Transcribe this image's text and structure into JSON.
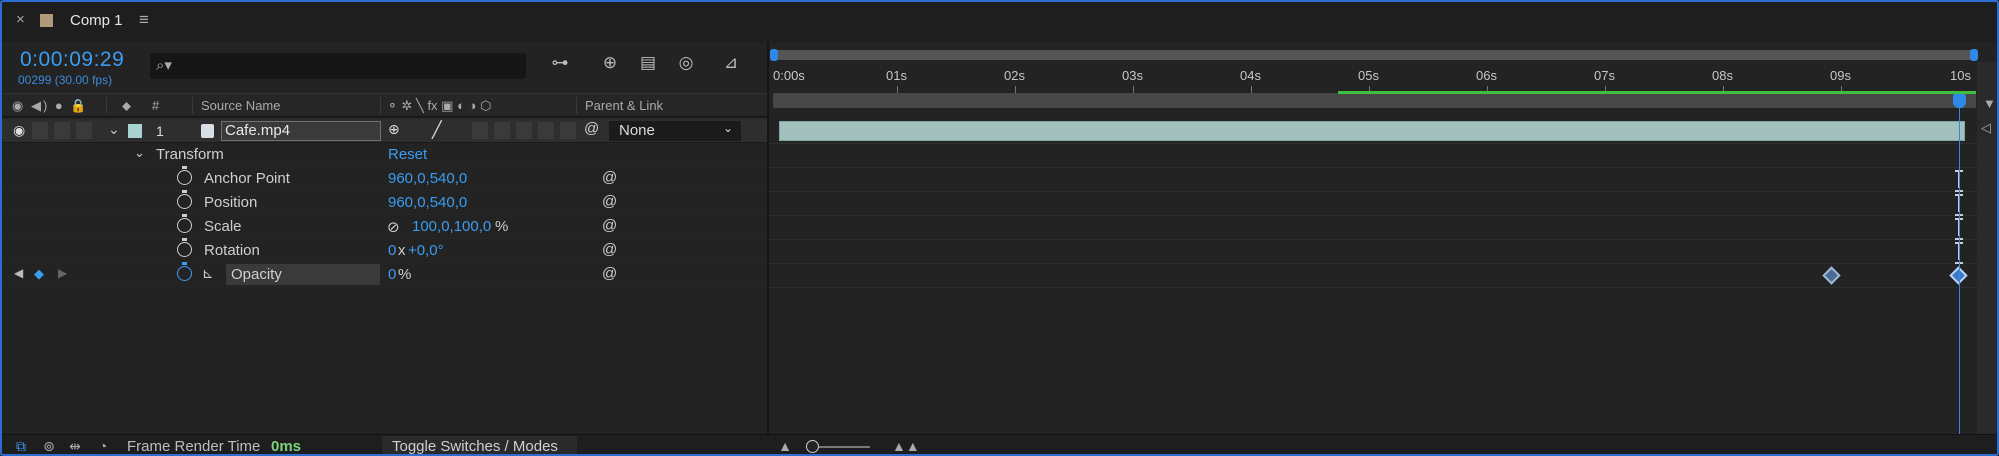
{
  "tab": {
    "close": "×",
    "title": "Comp 1",
    "menu": "≡"
  },
  "header": {
    "timecode": "0:00:09:29",
    "frame_info": "00299 (30.00 fps)",
    "search": {
      "placeholder": "",
      "icon": "search-icon"
    }
  },
  "columns": {
    "switch_icons": "◉ ◀) ● 🔒",
    "label": "⬥",
    "number": "#",
    "source_name": "Source Name",
    "switches": "⚬ ✲ ╲ fx ▣ ◐ ◑ ⬡",
    "parent": "Parent & Link"
  },
  "layer": {
    "number": "1",
    "name": "Cafe.mp4",
    "label_color": "#a9d3d0",
    "parent": "None",
    "parent_chevron": "⌄"
  },
  "transform": {
    "label": "Transform",
    "reset": "Reset",
    "properties": [
      {
        "name": "Anchor Point",
        "value": "960,0,540,0"
      },
      {
        "name": "Position",
        "value": "960,0,540,0"
      },
      {
        "name": "Scale",
        "link_icon": "⊘",
        "value": "100,0,100,0",
        "unit": "%"
      },
      {
        "name": "Rotation",
        "value_prefix": "0",
        "value_mid": "x",
        "value": "+0,0°"
      },
      {
        "name": "Opacity",
        "value": "0",
        "unit": "%"
      }
    ]
  },
  "timeline": {
    "ticks": [
      "0:00s",
      "01s",
      "02s",
      "03s",
      "04s",
      "05s",
      "06s",
      "07s",
      "08s",
      "09s",
      "10s"
    ],
    "accent": "#2e89e8",
    "cache_color": "#3fbf3f"
  },
  "statusbar": {
    "frame_render_label": "Frame Render Time",
    "frame_render_value": "0ms",
    "toggle_label": "Toggle Switches / Modes"
  }
}
